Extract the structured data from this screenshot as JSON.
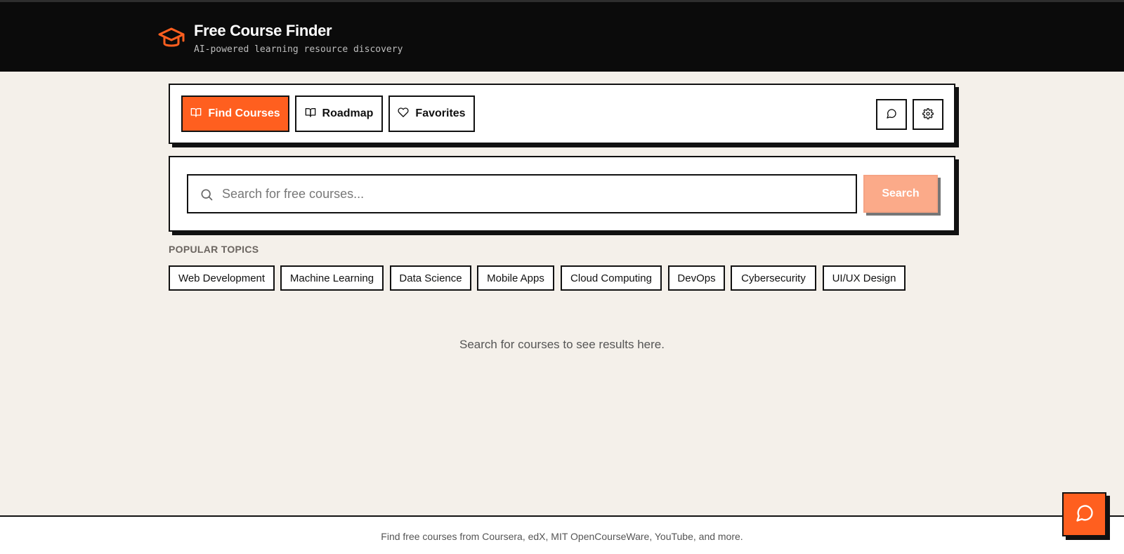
{
  "header": {
    "title": "Free Course Finder",
    "subtitle": "AI-powered learning resource discovery",
    "icon": "graduation-cap-icon"
  },
  "nav": {
    "items": [
      {
        "label": "Find Courses",
        "icon": "book-open-icon",
        "active": true
      },
      {
        "label": "Roadmap",
        "icon": "book-open-icon",
        "active": false
      },
      {
        "label": "Favorites",
        "icon": "heart-icon",
        "active": false
      }
    ],
    "chat_icon": "message-circle-icon",
    "settings_icon": "gear-icon"
  },
  "search": {
    "placeholder": "Search for free courses...",
    "value": "",
    "button_label": "Search"
  },
  "topics": {
    "label": "POPULAR TOPICS",
    "items": [
      "Web Development",
      "Machine Learning",
      "Data Science",
      "Mobile Apps",
      "Cloud Computing",
      "DevOps",
      "Cybersecurity",
      "UI/UX Design"
    ]
  },
  "results": {
    "empty_message": "Search for courses to see results here."
  },
  "footer": {
    "text": "Find free courses from Coursera, edX, MIT OpenCourseWare, YouTube, and more."
  },
  "colors": {
    "accent": "#ff5f1f",
    "background": "#f4f0ea",
    "header": "#0b0b0b"
  }
}
